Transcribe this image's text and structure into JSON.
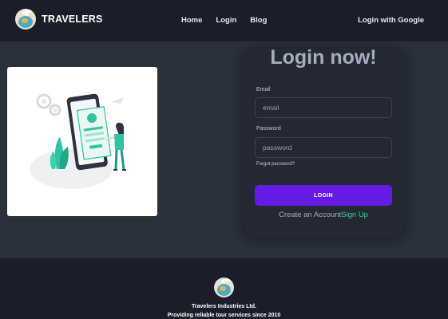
{
  "navbar": {
    "brand": "TRAVELERS",
    "links": [
      "Home",
      "Login",
      "Blog"
    ],
    "right_link": "Login with Google"
  },
  "login": {
    "title": "Login now!",
    "email_label": "Email",
    "email_placeholder": "email",
    "password_label": "Password",
    "password_placeholder": "password",
    "forgot": "Forgot password?",
    "button": "LOGIN",
    "create_text": "Create an Account",
    "signup_link": "Sign Up"
  },
  "footer": {
    "company": "Travelers Industries Ltd.",
    "tagline": "Providing reliable tour services since 2010"
  },
  "colors": {
    "background": "#2a303c",
    "navbar": "#191e2a",
    "accent": "#661ae6",
    "signup": "#36d399",
    "illustration": "#2ec4a0"
  },
  "icons": [
    "travel-logo-icon",
    "login-illustration"
  ]
}
